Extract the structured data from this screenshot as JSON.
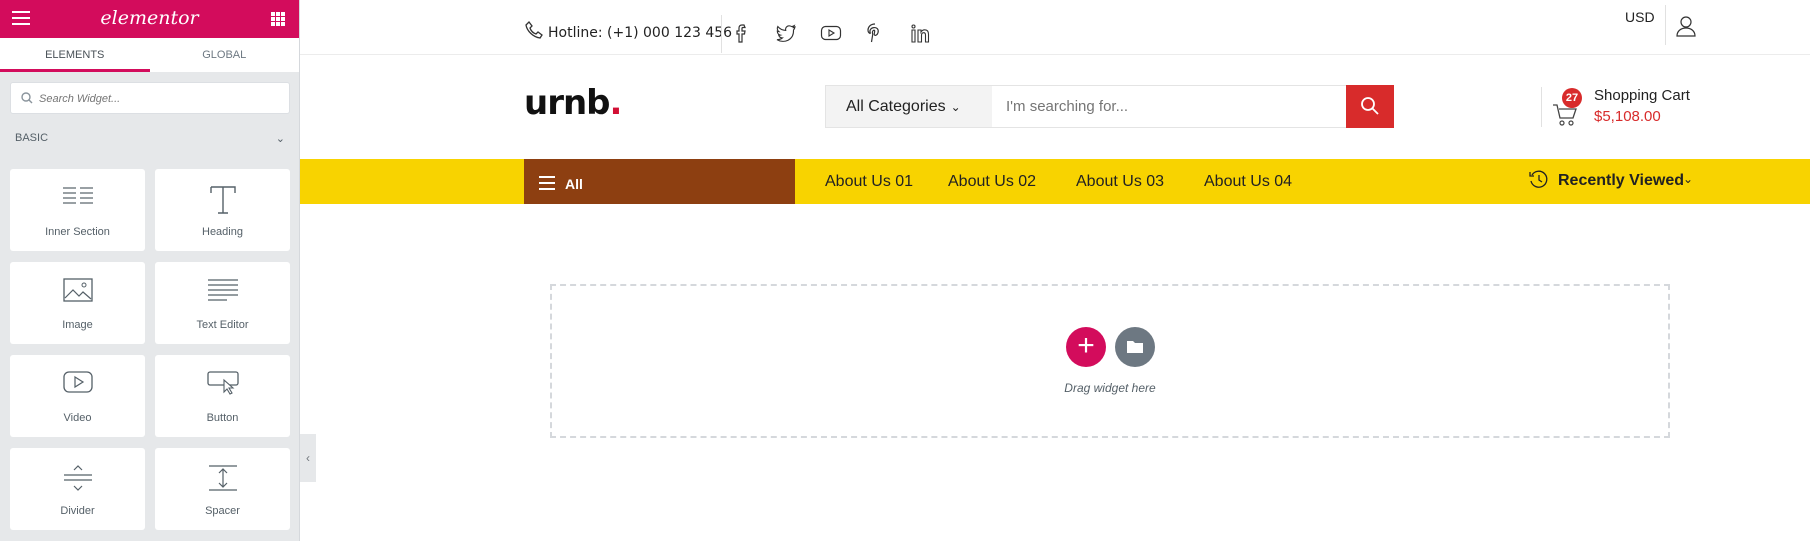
{
  "panel": {
    "logo": "elementor",
    "tabs": [
      {
        "label": "Elements"
      },
      {
        "label": "Global"
      }
    ],
    "search_placeholder": "Search Widget...",
    "category": "Basic",
    "widgets": [
      {
        "label": "Inner Section",
        "icon": "inner-section-icon"
      },
      {
        "label": "Heading",
        "icon": "heading-icon"
      },
      {
        "label": "Image",
        "icon": "image-icon"
      },
      {
        "label": "Text Editor",
        "icon": "text-editor-icon"
      },
      {
        "label": "Video",
        "icon": "video-icon"
      },
      {
        "label": "Button",
        "icon": "button-icon"
      },
      {
        "label": "Divider",
        "icon": "divider-icon"
      },
      {
        "label": "Spacer",
        "icon": "spacer-icon"
      }
    ],
    "accent": "#d30c5c"
  },
  "site": {
    "hotline": "Hotline: (+1) 000 123 456",
    "social": [
      "facebook-icon",
      "twitter-icon",
      "youtube-icon",
      "pinterest-icon",
      "linkedin-icon"
    ],
    "currency": "USD",
    "brand": "urnb",
    "brand_dot": ".",
    "category_select": "All Categories",
    "search_placeholder": "I'm searching for...",
    "cart": {
      "count": "27",
      "title": "Shopping Cart",
      "price": "$5,108.00"
    },
    "nav": {
      "all_label": "All",
      "links": [
        "About Us 01",
        "About Us 02",
        "About Us 03",
        "About Us 04"
      ],
      "recently_viewed": "Recently Viewed"
    },
    "colors": {
      "nav_bg": "#f8d300",
      "all_bg": "#8d3f11",
      "search_btn": "#d82b2b"
    }
  },
  "dropzone": {
    "text": "Drag widget here"
  }
}
